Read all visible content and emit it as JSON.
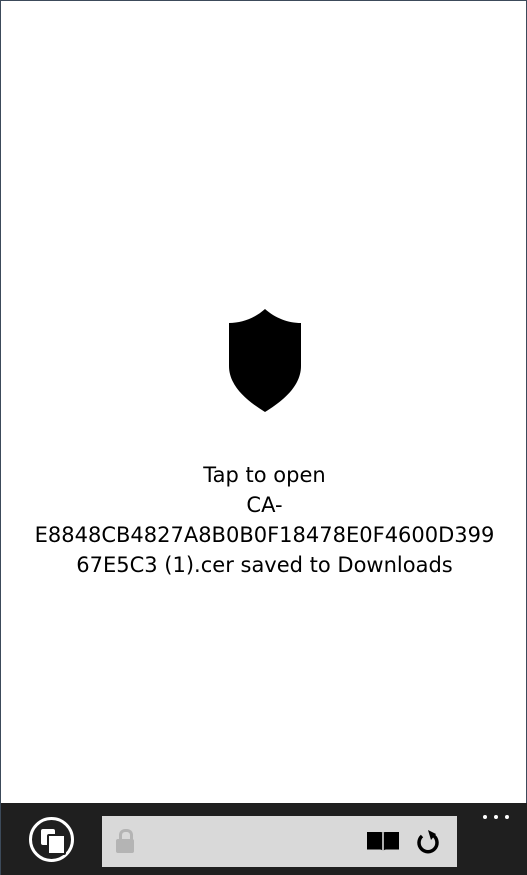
{
  "download": {
    "line1": "Tap to open",
    "line2": "CA-",
    "line3": "E8848CB4827A8B0B0F18478E0F4600D399",
    "line4": "67E5C3 (1).cer saved to Downloads",
    "icon": "shield-icon"
  },
  "appbar": {
    "tabs_icon": "tabs-icon",
    "address_value": "",
    "lock_icon": "lock-icon",
    "reader_icon": "reading-view-icon",
    "refresh_icon": "refresh-icon",
    "more_icon": "more-icon"
  },
  "colors": {
    "appbar_bg": "#1f1f1f",
    "address_bg": "#d9d9d9",
    "text": "#000000"
  }
}
